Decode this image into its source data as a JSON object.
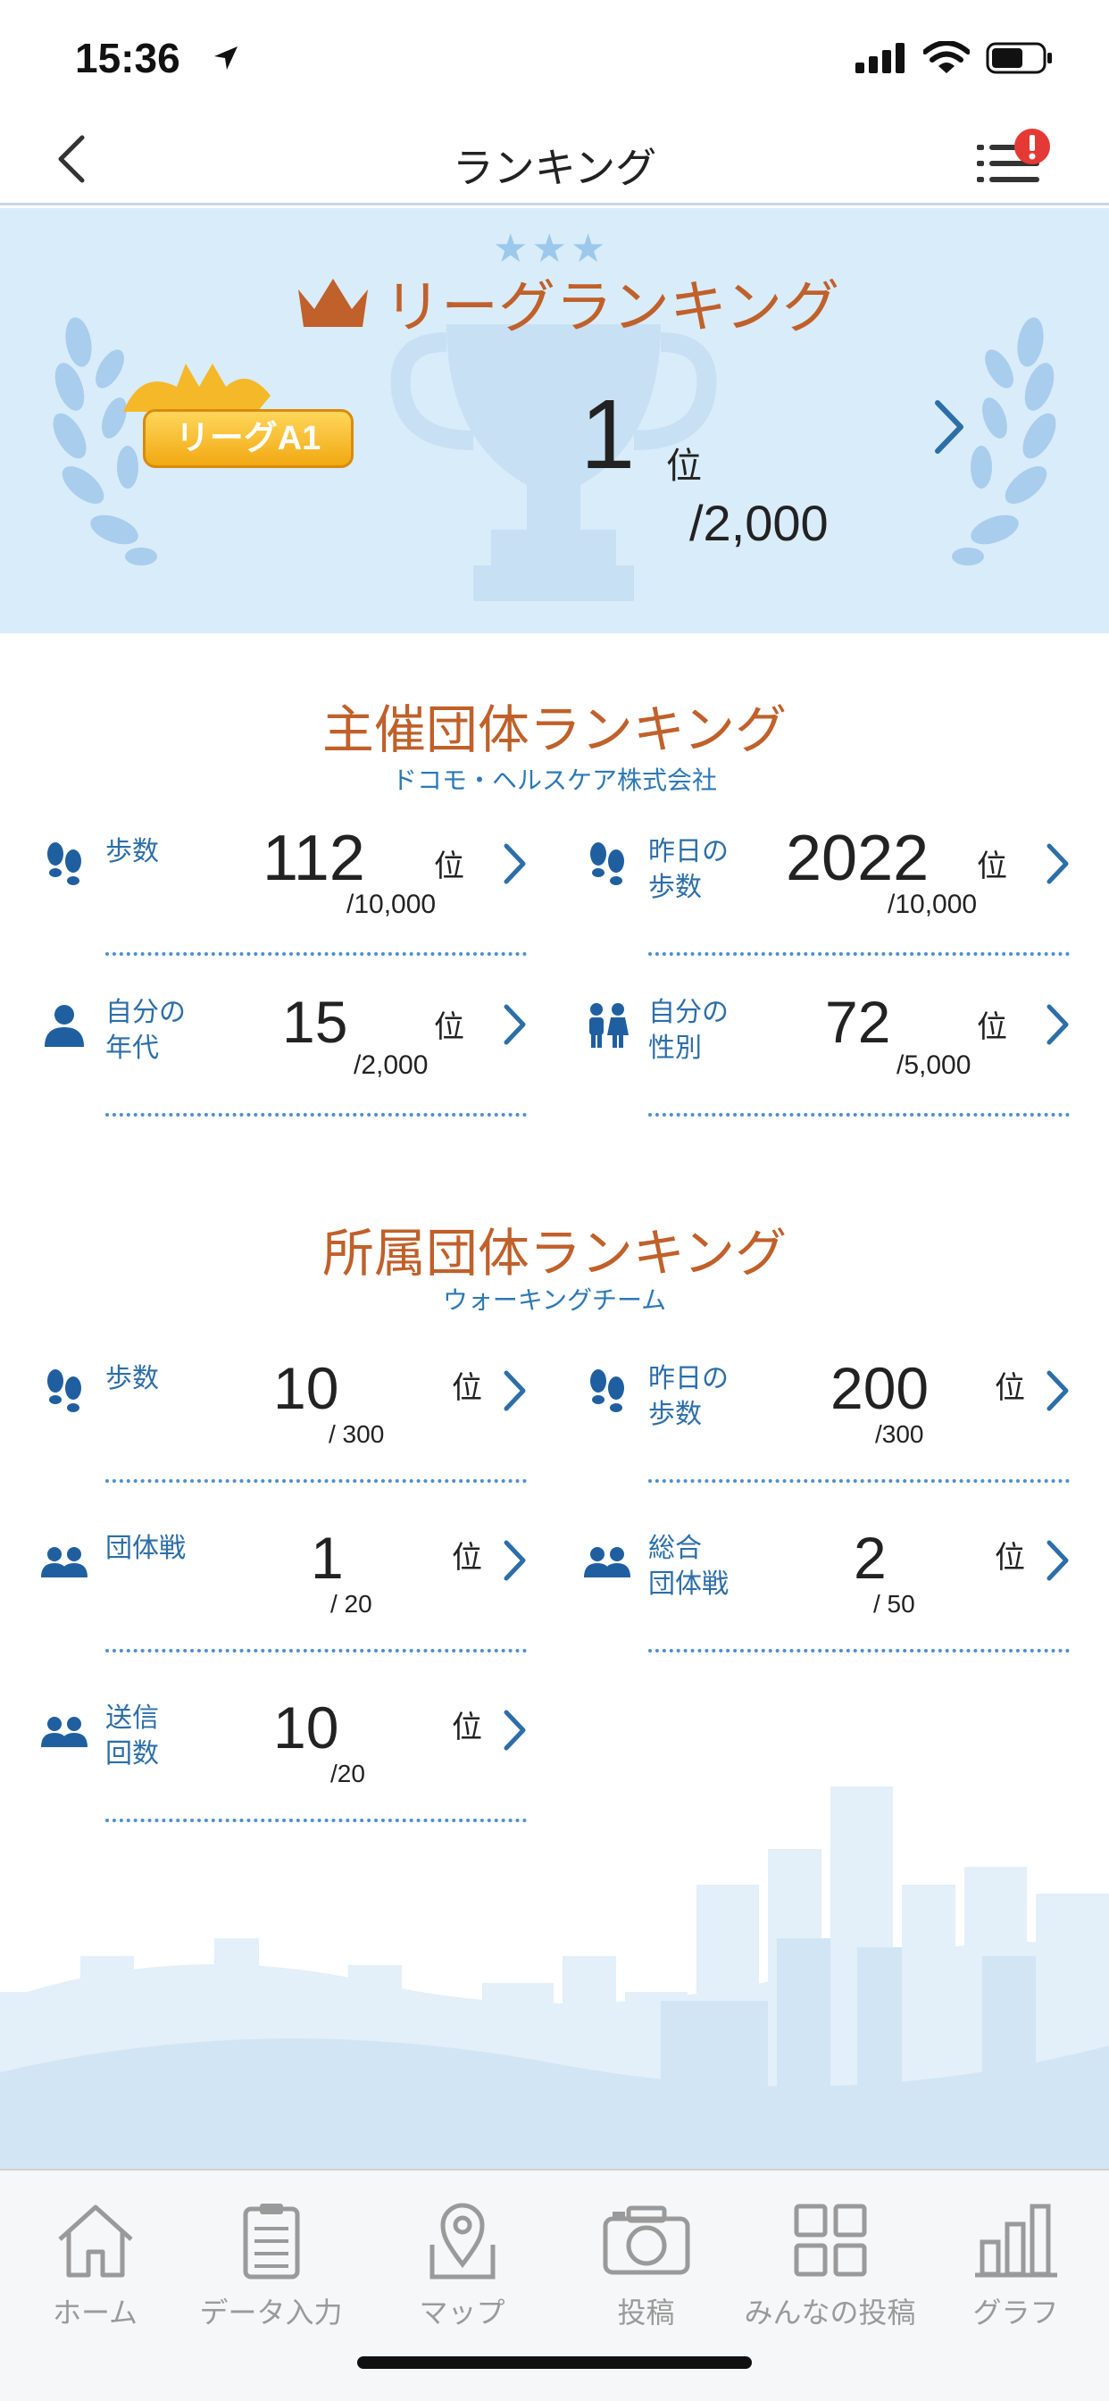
{
  "status": {
    "time": "15:36"
  },
  "nav": {
    "title": "ランキング"
  },
  "league": {
    "title": "リーグランキング",
    "badge": "リーグA1",
    "rank": "1",
    "rank_unit": "位",
    "total": "/2,000"
  },
  "sponsor": {
    "title": "主催団体ランキング",
    "subtitle": "ドコモ・ヘルスケア株式会社",
    "items": [
      {
        "label": "歩数",
        "value": "112",
        "unit": "位",
        "denominator": "/10,000",
        "icon": "footprints-icon"
      },
      {
        "label": "昨日の\n歩数",
        "value": "2022",
        "unit": "位",
        "denominator": "/10,000",
        "icon": "footprints-icon"
      },
      {
        "label": "自分の\n年代",
        "value": "15",
        "unit": "位",
        "denominator": "/2,000",
        "icon": "person-icon"
      },
      {
        "label": "自分の\n性別",
        "value": "72",
        "unit": "位",
        "denominator": "/5,000",
        "icon": "gender-icon"
      }
    ]
  },
  "group": {
    "title": "所属団体ランキング",
    "subtitle": "ウォーキングチーム",
    "items": [
      {
        "label": "歩数",
        "value": "10",
        "unit": "位",
        "denominator": "/ 300",
        "icon": "footprints-icon"
      },
      {
        "label": "昨日の\n歩数",
        "value": "200",
        "unit": "位",
        "denominator": "/300",
        "icon": "footprints-icon"
      },
      {
        "label": "団体戦",
        "value": "1",
        "unit": "位",
        "denominator": "/ 20",
        "icon": "group-icon"
      },
      {
        "label": "総合\n団体戦",
        "value": "2",
        "unit": "位",
        "denominator": "/ 50",
        "icon": "group-icon"
      },
      {
        "label": "送信\n回数",
        "value": "10",
        "unit": "位",
        "denominator": "/20",
        "icon": "group-icon"
      }
    ]
  },
  "tabs": [
    {
      "label": "ホーム",
      "icon": "home-icon"
    },
    {
      "label": "データ入力",
      "icon": "clipboard-icon"
    },
    {
      "label": "マップ",
      "icon": "map-icon"
    },
    {
      "label": "投稿",
      "icon": "camera-icon"
    },
    {
      "label": "みんなの投稿",
      "icon": "grid-icon"
    },
    {
      "label": "グラフ",
      "icon": "bar-chart-icon"
    }
  ],
  "colors": {
    "accent": "#2c78b6",
    "title": "#c0602a",
    "banner": "#d9ecfa",
    "alert": "#e53935"
  }
}
